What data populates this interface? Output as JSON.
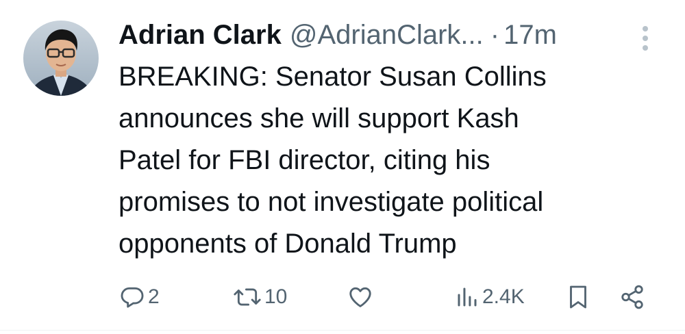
{
  "author": {
    "display_name": "Adrian Clark",
    "handle": "@AdrianClark...",
    "separator": "·",
    "time": "17m"
  },
  "tweet": {
    "lines": [
      "BREAKING: Senator Susan Collins",
      "announces she will support Kash",
      "Patel for FBI director, citing his",
      "promises to not investigate political",
      "opponents of Donald Trump"
    ]
  },
  "actions": {
    "replies": "2",
    "reposts": "10",
    "views": "2.4K"
  },
  "icons": {
    "avatar": "avatar",
    "more": "more-vertical-icon",
    "reply": "reply-icon",
    "repost": "repost-icon",
    "like": "heart-icon",
    "views": "views-icon",
    "bookmark": "bookmark-icon",
    "share": "share-icon"
  },
  "colors": {
    "text": "#0f1419",
    "secondary": "#536471",
    "icon": "#536471",
    "more": "#b8c3cb",
    "divider": "#eff3f4"
  }
}
